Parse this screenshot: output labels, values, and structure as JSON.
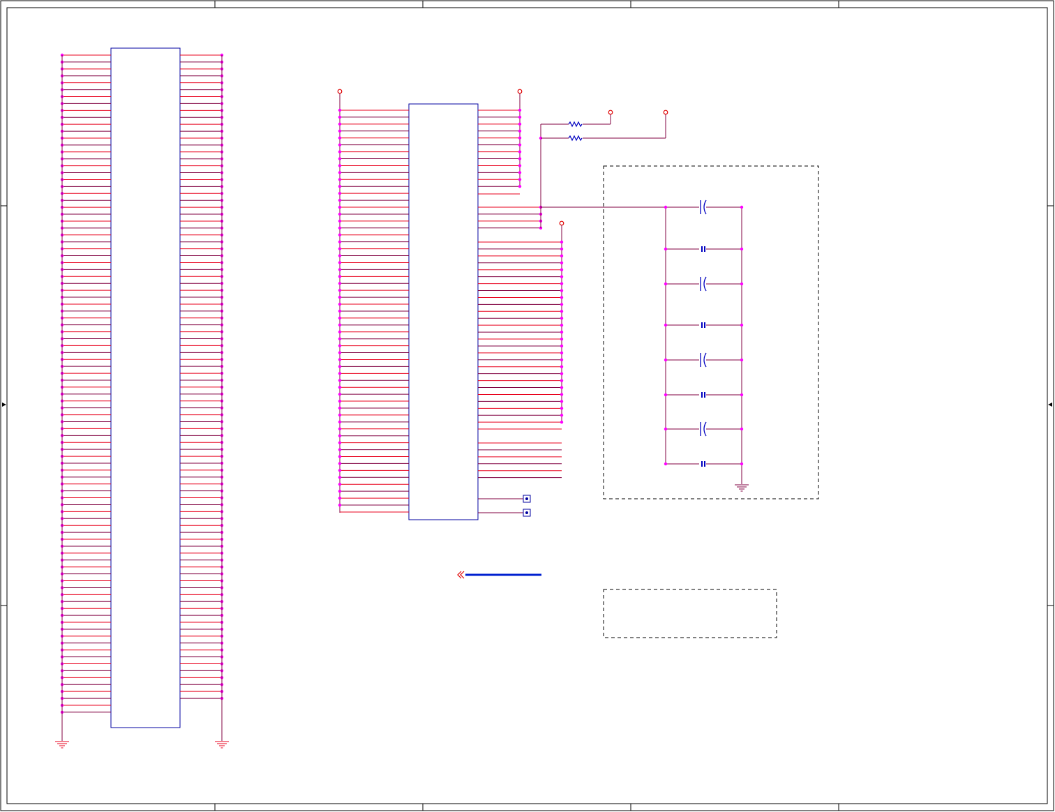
{
  "colors": {
    "frame": "#000000",
    "wire_red": "#e8001c",
    "wire_purple": "#800040",
    "wire_blue": "#0000c0",
    "junction": "#ff00ff",
    "power_pin": "#e00000",
    "arrow": "#0020d0",
    "dashed_box": "#000000"
  },
  "connector_left": {
    "left_pin_count": 96,
    "right_pin_count": 94,
    "ground_symbols": 2
  },
  "connector_middle": {
    "left_pin_count": 59,
    "top_right_pins": 12,
    "mid_right_pins": 4,
    "lower_right_junction_pins": 27,
    "lower_right_open_pins": 6,
    "test_points": 2,
    "power_pins": 3
  },
  "resistors": {
    "count": 2,
    "power_pins": 2
  },
  "decoupling_group": {
    "capacitor_icons": [
      "polarized-capacitor-icon",
      "ceramic-capacitor-icon",
      "polarized-capacitor-icon",
      "ceramic-capacitor-icon",
      "polarized-capacitor-icon",
      "ceramic-capacitor-icon",
      "polarized-capacitor-icon",
      "ceramic-capacitor-icon"
    ],
    "ground_symbols": 1
  },
  "annotations": {
    "arrow_icon": "double-chevron-left-arrow-icon",
    "empty_note_box": true
  }
}
